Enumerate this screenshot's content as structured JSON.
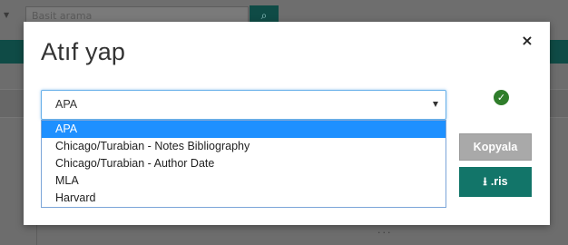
{
  "background": {
    "search_placeholder": "Basit arama",
    "search_icon": "search-icon",
    "dots": "..."
  },
  "modal": {
    "title": "Atıf yap",
    "close_label": "×",
    "style_select": {
      "value": "APA",
      "options": [
        "APA",
        "Chicago/Turabian - Notes Bibliography",
        "Chicago/Turabian - Author Date",
        "MLA",
        "Harvard"
      ],
      "selected_index": 0
    },
    "status_icon": "check-circle-icon",
    "copy_label": "Kopyala",
    "ris_label": ".ris",
    "ris_icon": "download-icon"
  },
  "colors": {
    "accent_teal": "#127569",
    "selected_option": "#1e90ff",
    "success_green": "#2f7d2b",
    "disabled_button": "#a9a9a9"
  }
}
